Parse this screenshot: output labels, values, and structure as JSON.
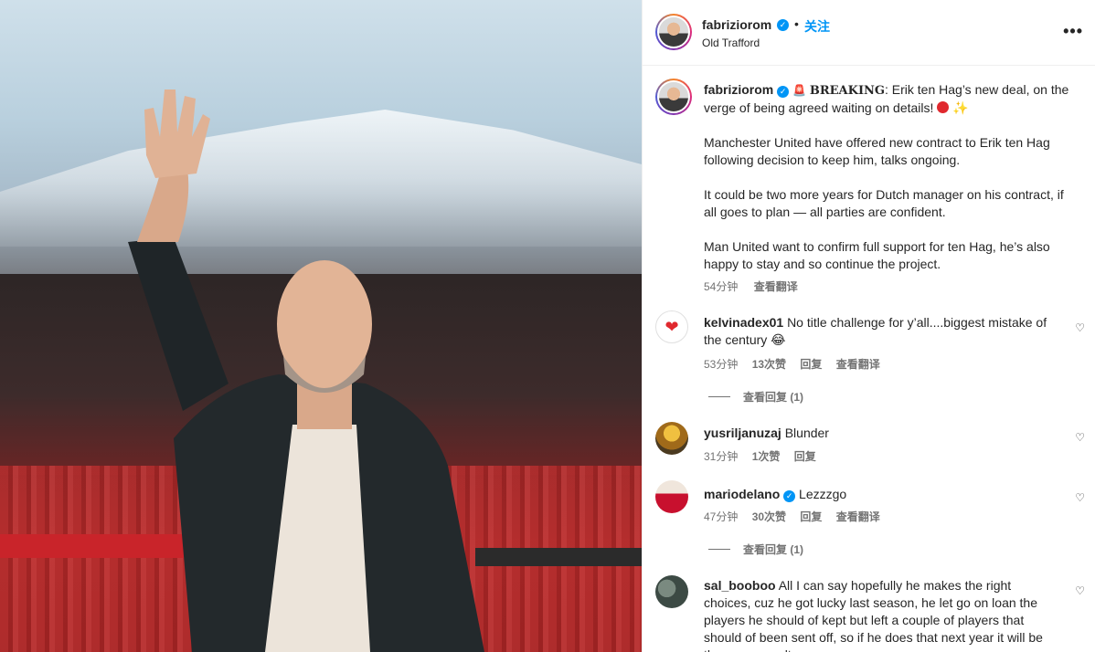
{
  "post": {
    "username": "fabriziorom",
    "dot": "•",
    "follow_label": "关注",
    "location": "Old Trafford",
    "more_label": "•••"
  },
  "caption": {
    "username": "fabriziorom",
    "breaking": "BREAKING",
    "headline": ": Erik ten Hag’s new deal, on the verge of being agreed waiting on details!",
    "paragraphs": [
      "Manchester United have offered new contract to Erik ten Hag following decision to keep him, talks ongoing.",
      "It could be two more years for Dutch manager on his contract, if all goes to plan — all parties are confident.",
      "Man United want to confirm full support for ten Hag, he’s also happy to stay and so continue the project."
    ],
    "time": "54分钟",
    "translate": "查看翻译"
  },
  "comments": [
    {
      "username": "kelvinadex01",
      "text": "No title challenge for y’all....biggest mistake of the century 😂",
      "time": "53分钟",
      "likes": "13次赞",
      "reply": "回复",
      "translate": "查看翻译",
      "view_replies": "查看回复 (1)"
    },
    {
      "username": "yusriljanuzaj",
      "text": "Blunder",
      "time": "31分钟",
      "likes": "1次赞",
      "reply": "回复"
    },
    {
      "username": "mariodelano",
      "text": "Lezzzgo",
      "time": "47分钟",
      "likes": "30次赞",
      "reply": "回复",
      "translate": "查看翻译",
      "view_replies": "查看回复 (1)"
    },
    {
      "username": "sal_booboo",
      "text": "All I can say hopefully he makes the right choices, cuz he got lucky last season, he let go on loan the players he should of kept but left a couple of players that should of been sent off, so if he does that next year it will be the same result"
    }
  ],
  "icons": {
    "verified": "verified-badge-icon",
    "heart": "heart-outline-icon",
    "more": "more-horizontal-icon"
  },
  "colors": {
    "accent": "#0095f6",
    "text": "#262626",
    "secondary": "#737373"
  }
}
